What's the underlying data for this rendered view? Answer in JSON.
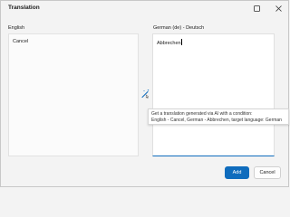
{
  "window": {
    "title": "Translation"
  },
  "source": {
    "language_label": "English",
    "text": "Cancel"
  },
  "target": {
    "language_label": "German (de) - Deutsch",
    "text": "Abbrechen"
  },
  "ai_button": {
    "icon": "magic-wand-icon"
  },
  "tooltip": {
    "line1": "Get a translation generated via AI with a condition:",
    "line2": "English - Cancel, German - Abbrechen, target language: German"
  },
  "actions": {
    "add_label": "Add",
    "cancel_label": "Cancel"
  },
  "colors": {
    "accent": "#0f6cbd"
  }
}
